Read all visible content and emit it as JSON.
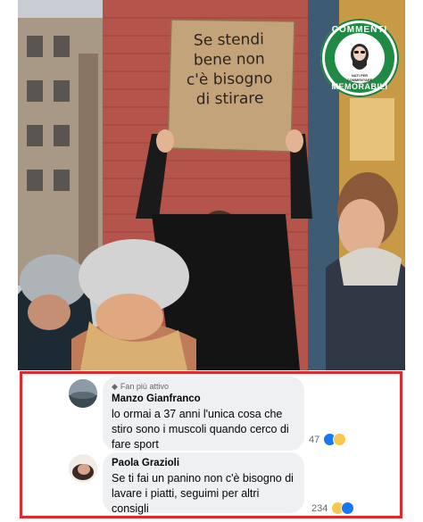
{
  "sign": {
    "lines": [
      "Se stendi",
      "bene non",
      "c'è bisogno",
      "di stirare"
    ]
  },
  "badge": {
    "top_text": "COMMENTI",
    "bottom_text": "MEMORABILI",
    "small_text": "NATI PER COMMENTARE",
    "colors": {
      "ring": "#1f8a43"
    }
  },
  "comments": [
    {
      "fan_badge": "Fan più attivo",
      "author": "Manzo Gianfranco",
      "text": "lo ormai a 37 anni l'unica cosa che\nstiro sono i muscoli quando cerco di\nfare sport",
      "reaction_count": "47",
      "reactions": [
        "like-icon",
        "haha-icon"
      ]
    },
    {
      "author": "Paola Grazioli",
      "text": "Se ti fai un panino non c'è bisogno di\nlavare i piatti, seguimi per altri\nconsigli",
      "reaction_count": "234",
      "reactions": [
        "haha-icon",
        "like-icon"
      ]
    }
  ],
  "colors": {
    "frame_border": "#e0282f",
    "bubble": "#eff0f2"
  }
}
